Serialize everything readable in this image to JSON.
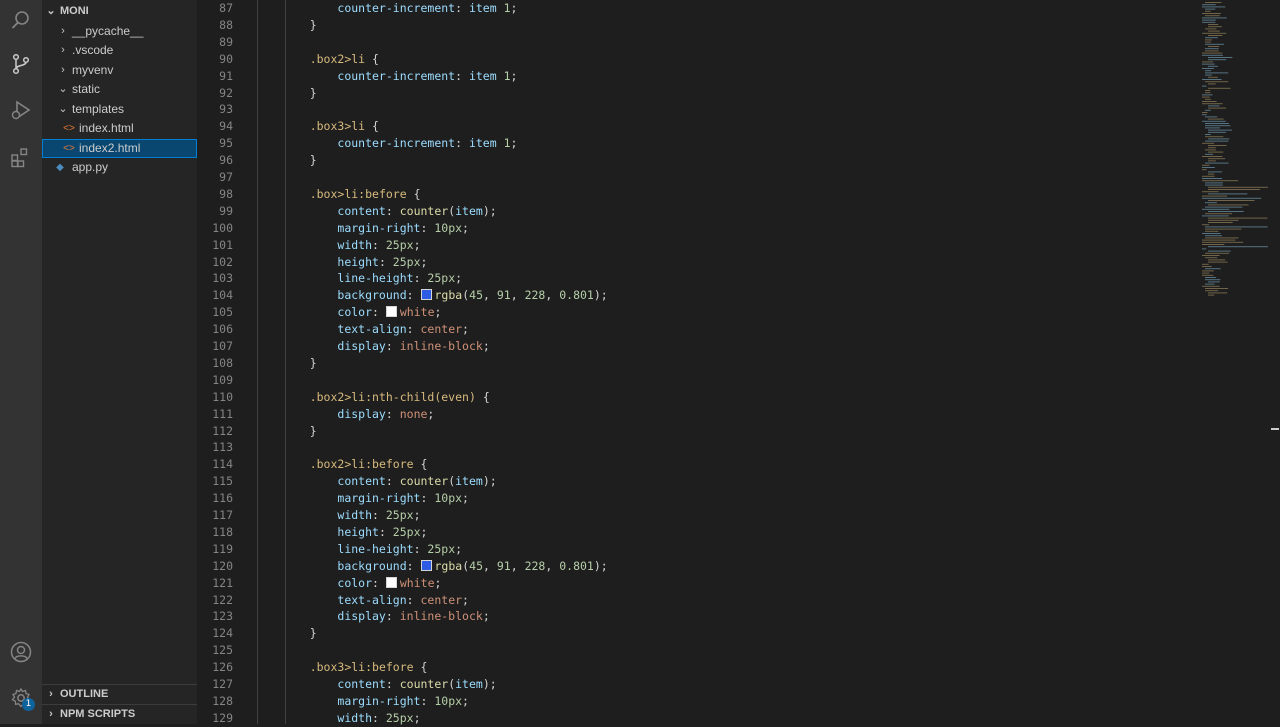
{
  "explorer": {
    "root": "MONI",
    "items": [
      {
        "label": "__pycache__",
        "type": "folder",
        "expanded": false,
        "depth": 1
      },
      {
        "label": ".vscode",
        "type": "folder",
        "expanded": false,
        "depth": 1
      },
      {
        "label": "myvenv",
        "type": "folder",
        "expanded": false,
        "depth": 1
      },
      {
        "label": "static",
        "type": "folder",
        "expanded": true,
        "depth": 1
      },
      {
        "label": "templates",
        "type": "folder",
        "expanded": true,
        "depth": 1
      },
      {
        "label": "index.html",
        "type": "html",
        "depth": 2
      },
      {
        "label": "index2.html",
        "type": "html",
        "depth": 2,
        "selected": true
      },
      {
        "label": "app.py",
        "type": "python",
        "depth": 1
      }
    ],
    "outline_label": "OUTLINE",
    "npm_label": "NPM SCRIPTS"
  },
  "activity": {
    "icons": [
      "search-icon",
      "source-control-icon",
      "run-debug-icon",
      "extensions-icon",
      "account-icon",
      "settings-gear-icon"
    ],
    "settings_badge": "1"
  },
  "colors": {
    "selector": "#d7ba7d",
    "property": "#9cdcfe",
    "value": "#ce9178",
    "number": "#b5cea8",
    "function": "#dcdcaa",
    "swatch_blue": "#2d5be4",
    "swatch_white": "#ffffff"
  },
  "editor": {
    "lines": [
      {
        "n": "87",
        "text": "        counter-increment: item 1;"
      },
      {
        "n": "88",
        "text": "    }"
      },
      {
        "n": "89",
        "text": ""
      },
      {
        "n": "90",
        "text": "    .box2>li {"
      },
      {
        "n": "91",
        "text": "        counter-increment: item 1;"
      },
      {
        "n": "92",
        "text": "    }"
      },
      {
        "n": "93",
        "text": ""
      },
      {
        "n": "94",
        "text": "    .box3>li {"
      },
      {
        "n": "95",
        "text": "        counter-increment: item 1;"
      },
      {
        "n": "96",
        "text": "    }"
      },
      {
        "n": "97",
        "text": ""
      },
      {
        "n": "98",
        "text": "    .box>li:before {"
      },
      {
        "n": "99",
        "text": "        content: counter(item);"
      },
      {
        "n": "100",
        "text": "        margin-right: 10px;"
      },
      {
        "n": "101",
        "text": "        width: 25px;"
      },
      {
        "n": "102",
        "text": "        height: 25px;"
      },
      {
        "n": "103",
        "text": "        line-height: 25px;"
      },
      {
        "n": "104",
        "text": "        background: rgba(45, 91, 228, 0.801);"
      },
      {
        "n": "105",
        "text": "        color: white;"
      },
      {
        "n": "106",
        "text": "        text-align: center;"
      },
      {
        "n": "107",
        "text": "        display: inline-block;"
      },
      {
        "n": "108",
        "text": "    }"
      },
      {
        "n": "109",
        "text": ""
      },
      {
        "n": "110",
        "text": "    .box2>li:nth-child(even) {"
      },
      {
        "n": "111",
        "text": "        display: none;"
      },
      {
        "n": "112",
        "text": "    }"
      },
      {
        "n": "113",
        "text": ""
      },
      {
        "n": "114",
        "text": "    .box2>li:before {"
      },
      {
        "n": "115",
        "text": "        content: counter(item);"
      },
      {
        "n": "116",
        "text": "        margin-right: 10px;"
      },
      {
        "n": "117",
        "text": "        width: 25px;"
      },
      {
        "n": "118",
        "text": "        height: 25px;"
      },
      {
        "n": "119",
        "text": "        line-height: 25px;"
      },
      {
        "n": "120",
        "text": "        background: rgba(45, 91, 228, 0.801);"
      },
      {
        "n": "121",
        "text": "        color: white;"
      },
      {
        "n": "122",
        "text": "        text-align: center;"
      },
      {
        "n": "123",
        "text": "        display: inline-block;"
      },
      {
        "n": "124",
        "text": "    }"
      },
      {
        "n": "125",
        "text": ""
      },
      {
        "n": "126",
        "text": "    .box3>li:before {"
      },
      {
        "n": "127",
        "text": "        content: counter(item);"
      },
      {
        "n": "128",
        "text": "        margin-right: 10px;"
      },
      {
        "n": "129",
        "text": "        width: 25px;"
      }
    ]
  }
}
